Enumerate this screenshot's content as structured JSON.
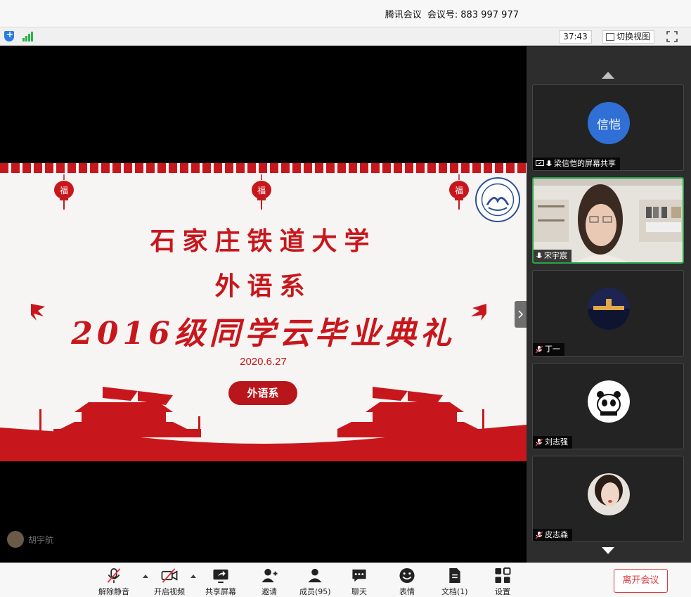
{
  "window": {
    "app_name": "腾讯会议",
    "meeting_id_label": "会议号:",
    "meeting_id": "883 997 977"
  },
  "statusbar": {
    "timer": "37:43",
    "switch_view_label": "切换视图"
  },
  "slide": {
    "title_line1": "石家庄铁道大学",
    "title_line2": "外语系",
    "title_line3": "2016级同学云毕业典礼",
    "date": "2020.6.27",
    "badge": "外语系",
    "lantern_char": "福"
  },
  "self_user": {
    "name": "胡宇航"
  },
  "participants": [
    {
      "name": "梁信恺的屏幕共享",
      "avatar_text": "信恺",
      "avatar_color": "#2f6fd6",
      "type": "screen-share"
    },
    {
      "name": "宋宇宸",
      "type": "video",
      "active": true
    },
    {
      "name": "丁一",
      "type": "avatar-photo",
      "muted": true
    },
    {
      "name": "刘志强",
      "type": "avatar-photo",
      "muted": true
    },
    {
      "name": "皮志森",
      "type": "avatar-photo",
      "muted": true
    }
  ],
  "toolbar": {
    "unmute": "解除静音",
    "start_video": "开启视频",
    "share_screen": "共享屏幕",
    "invite": "邀请",
    "members": "成员(95)",
    "chat": "聊天",
    "reactions": "表情",
    "documents": "文档(1)",
    "settings": "设置",
    "leave": "离开会议"
  },
  "colors": {
    "accent_red": "#c8171c",
    "active_green": "#27a34a",
    "leave_red": "#e0383e"
  }
}
